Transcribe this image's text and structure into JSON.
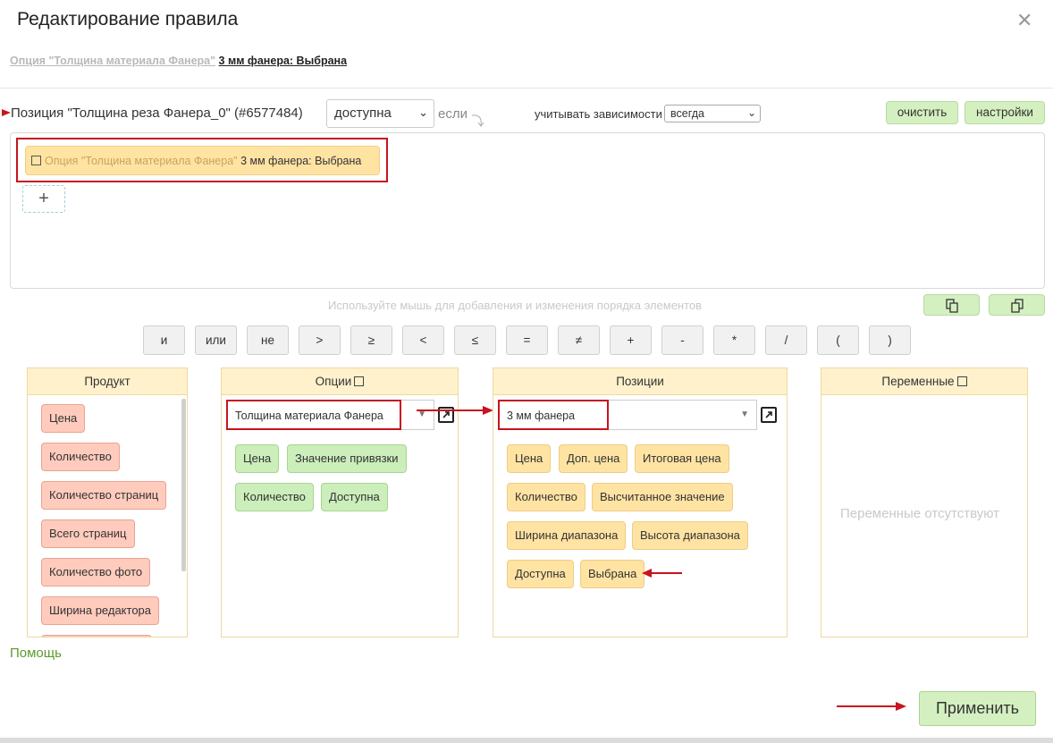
{
  "dialog": {
    "title": "Редактирование правила",
    "close_icon": "close-icon"
  },
  "subtitle": {
    "option_text": "Опция \"Толщина материала Фанера\"",
    "value_text": "3 мм фанера: Выбрана"
  },
  "rule_header": {
    "position_label": "Позиция \"Толщина реза Фанера_0\" (#6577484)",
    "availability_value": "доступна",
    "if_label": "если",
    "deps_label": "учитывать зависимости",
    "deps_value": "всегда",
    "clear_button": "очистить",
    "settings_button": "настройки"
  },
  "rule_condition": {
    "icon": "external-link-icon",
    "option_text": "Опция \"Толщина материала Фанера\"",
    "value_text": "3 мм фанера: Выбрана",
    "add_button": "+"
  },
  "hint": "Используйте мышь для добавления и изменения порядка элементов",
  "operators": [
    "и",
    "или",
    "не",
    ">",
    "≥",
    "<",
    "≤",
    "=",
    "≠",
    "+",
    "-",
    "*",
    "/",
    "(",
    ")"
  ],
  "panels": {
    "product": {
      "title": "Продукт",
      "items": [
        "Цена",
        "Количество",
        "Количество страниц",
        "Всего страниц",
        "Количество фото",
        "Ширина редактора"
      ]
    },
    "options": {
      "title": "Опции",
      "selected": "Толщина материала Фанера",
      "items": [
        "Цена",
        "Значение привязки",
        "Количество",
        "Доступна"
      ]
    },
    "positions": {
      "title": "Позиции",
      "selected": "3 мм фанера",
      "items": [
        "Цена",
        "Доп. цена",
        "Итоговая цена",
        "Количество",
        "Высчитанное значение",
        "Ширина диапазона",
        "Высота диапазона",
        "Доступна",
        "Выбрана"
      ]
    },
    "variables": {
      "title": "Переменные",
      "empty_text": "Переменные отсутствуют"
    }
  },
  "footer": {
    "help": "Помощь",
    "apply": "Применить"
  },
  "colors": {
    "annotation_red": "#c7141d",
    "green_button": "#d4f0c0",
    "chip_yellow": "#ffe3a3",
    "chip_red": "#ffcbbd",
    "chip_green": "#cbeebb"
  }
}
